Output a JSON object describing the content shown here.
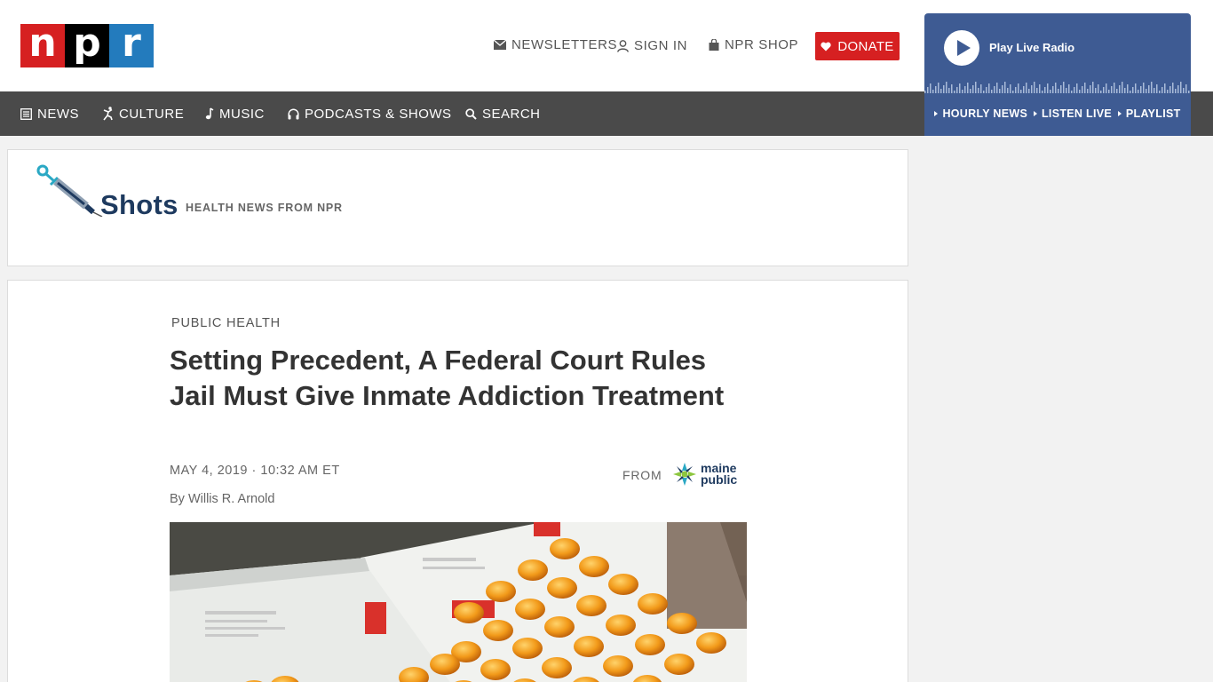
{
  "header": {
    "logo_letters": [
      "n",
      "p",
      "r"
    ],
    "utility": {
      "newsletters": "NEWSLETTERS",
      "sign_in": "SIGN IN",
      "shop": "NPR SHOP",
      "donate": "DONATE"
    }
  },
  "nav": {
    "news": "NEWS",
    "culture": "CULTURE",
    "music": "MUSIC",
    "podcasts": "PODCASTS & SHOWS",
    "search": "SEARCH"
  },
  "player": {
    "label": "Play Live Radio",
    "links": [
      "HOURLY NEWS",
      "LISTEN LIVE",
      "PLAYLIST"
    ]
  },
  "shots": {
    "title": "Shots",
    "tagline": "HEALTH NEWS FROM NPR"
  },
  "article": {
    "slug": "PUBLIC HEALTH",
    "headline": "Setting Precedent, A Federal Court Rules Jail Must Give Inmate Addiction Treatment",
    "dateline": "MAY 4, 2019 · 10:32 AM ET",
    "byline_prefix": "By",
    "author": "Willis R. Arnold",
    "from_label": "FROM",
    "station_line1": "maine",
    "station_line2": "public"
  },
  "colors": {
    "npr_red": "#d62021",
    "npr_black": "#000000",
    "npr_blue": "#237bbd",
    "nav_bg": "#4a4a4a",
    "player_bg": "#3e5b93"
  }
}
